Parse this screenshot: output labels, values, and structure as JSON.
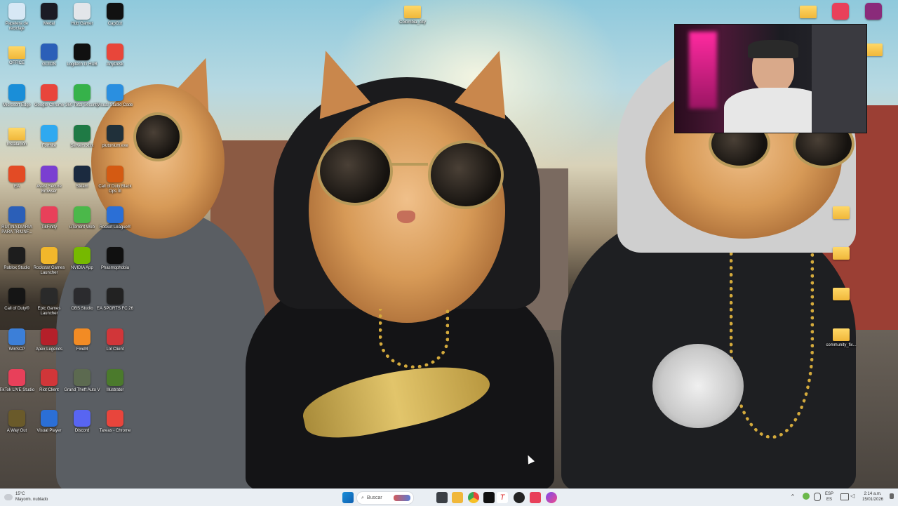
{
  "desktop": {
    "icons": [
      {
        "label": "Papelera de reciclaje",
        "icon": "recycle-bin-icon",
        "color": "#d7e8f5"
      },
      {
        "label": "Medal",
        "icon": "medal-icon",
        "color": "#1b1b24"
      },
      {
        "label": "Hub Gamer",
        "icon": "gamepad-icon",
        "color": "#e3e6ea"
      },
      {
        "label": "CapCut",
        "icon": "capcut-icon",
        "color": "#111111"
      },
      {
        "label": "OFFICE",
        "icon": "folder-icon",
        "color": "#f0b73a"
      },
      {
        "label": "GUION",
        "icon": "word-icon",
        "color": "#2b5fb8"
      },
      {
        "label": "Logitech G HUB",
        "icon": "logitech-icon",
        "color": "#101010"
      },
      {
        "label": "AnyDesk",
        "icon": "anydesk-icon",
        "color": "#e8463a"
      },
      {
        "label": "Microsoft Edge",
        "icon": "edge-icon",
        "color": "#1a8ed8"
      },
      {
        "label": "Google Chrome",
        "icon": "chrome-icon",
        "color": "#e8453c"
      },
      {
        "label": "360 Total Security",
        "icon": "shield-plus-icon",
        "color": "#36b24a"
      },
      {
        "label": "Visual Studio Code",
        "icon": "vscode-icon",
        "color": "#2a8fe0"
      },
      {
        "label": "Instalación",
        "icon": "folder-icon",
        "color": "#f0b73a"
      },
      {
        "label": "Fortnite",
        "icon": "fortnite-icon",
        "color": "#2fa9f0"
      },
      {
        "label": "Servers.xlsx",
        "icon": "excel-icon",
        "color": "#1f7a45"
      },
      {
        "label": "plutonium.exe",
        "icon": "atom-icon",
        "color": "#20303a"
      },
      {
        "label": "EA",
        "icon": "ea-icon",
        "color": "#e34b25"
      },
      {
        "label": "Avast Secure Browser",
        "icon": "avast-icon",
        "color": "#7a3fd1"
      },
      {
        "label": "Steam",
        "icon": "steam-icon",
        "color": "#1b2a3f"
      },
      {
        "label": "Call of Duty Black Ops III",
        "icon": "cod-bo3-icon",
        "color": "#d45a12"
      },
      {
        "label": "RUTINA DIARIA PARA TRIUNF...",
        "icon": "word-icon",
        "color": "#2b5fb8"
      },
      {
        "label": "TikFinity",
        "icon": "tikfinity-icon",
        "color": "#e8405a"
      },
      {
        "label": "uTorrent Web",
        "icon": "utorrent-icon",
        "color": "#4bb84a"
      },
      {
        "label": "Rocket League®",
        "icon": "rocket-league-icon",
        "color": "#2b6fd6"
      },
      {
        "label": "Roblox Studio",
        "icon": "roblox-icon",
        "color": "#1d1d1d"
      },
      {
        "label": "Rockstar Games Launcher",
        "icon": "rockstar-icon",
        "color": "#f2b72b"
      },
      {
        "label": "NVIDIA App",
        "icon": "nvidia-icon",
        "color": "#76b900"
      },
      {
        "label": "Phasmophobia",
        "icon": "phasmophobia-icon",
        "color": "#101010"
      },
      {
        "label": "Call of Duty®",
        "icon": "cod-icon",
        "color": "#151515"
      },
      {
        "label": "Epic Games Launcher",
        "icon": "epic-icon",
        "color": "#2a2a2a"
      },
      {
        "label": "OBS Studio",
        "icon": "obs-icon",
        "color": "#2b2b2e"
      },
      {
        "label": "EA SPORTS FC 26",
        "icon": "fc26-icon",
        "color": "#222222"
      },
      {
        "label": "WinSCP",
        "icon": "winscp-icon",
        "color": "#3c7fd8"
      },
      {
        "label": "Apex Legends",
        "icon": "apex-icon",
        "color": "#b5202a"
      },
      {
        "label": "FiveM",
        "icon": "fivem-icon",
        "color": "#f28b24"
      },
      {
        "label": "Lol Client",
        "icon": "riot-icon",
        "color": "#d13639"
      },
      {
        "label": "TikTok LIVE Studio",
        "icon": "tiktok-live-icon",
        "color": "#e8405a"
      },
      {
        "label": "Riot Client",
        "icon": "riot-icon",
        "color": "#d13639"
      },
      {
        "label": "Grand Theft Auto V",
        "icon": "gta-icon",
        "color": "#5c6a50"
      },
      {
        "label": "Illustrator",
        "icon": "minecraft-icon",
        "color": "#4b7a2c"
      },
      {
        "label": "A Way Out",
        "icon": "a-way-out-icon",
        "color": "#6a5a2a"
      },
      {
        "label": "Visual Player",
        "icon": "player-icon",
        "color": "#2b6fd6"
      },
      {
        "label": "Discord",
        "icon": "discord-icon",
        "color": "#5865f2"
      },
      {
        "label": "Tareas - Chrome",
        "icon": "chrome-icon",
        "color": "#e8453c"
      }
    ],
    "top_folder": {
      "label": "Colombia_city",
      "icon": "folder-icon"
    },
    "right_icons": [
      {
        "label": "",
        "icon": "folder-icon"
      },
      {
        "label": "",
        "icon": "document-icon"
      },
      {
        "label": "",
        "icon": "winrar-icon"
      },
      {
        "label": "",
        "icon": "folder-icon"
      },
      {
        "label": "",
        "icon": "folder-icon"
      },
      {
        "label": "",
        "icon": "folder-icon"
      },
      {
        "label": "",
        "icon": "folder-icon"
      },
      {
        "label": "community_fix...",
        "icon": "folder-icon"
      }
    ]
  },
  "webcam": {
    "description_icon": "webcam-overlay-icon"
  },
  "taskbar": {
    "weather": {
      "temp": "15°C",
      "condition": "Mayorm. nublado"
    },
    "search_placeholder": "Buscar",
    "apps": [
      "windows-start-icon",
      "task-view-icon",
      "file-explorer-icon",
      "chrome-icon",
      "tiktok-icon",
      "trello-icon",
      "obs-icon",
      "capcut-icon",
      "messenger-icon"
    ],
    "tray": {
      "lang": "ESP",
      "region": "ES",
      "time": "2:14 a.m.",
      "date": "15/01/2026"
    }
  }
}
